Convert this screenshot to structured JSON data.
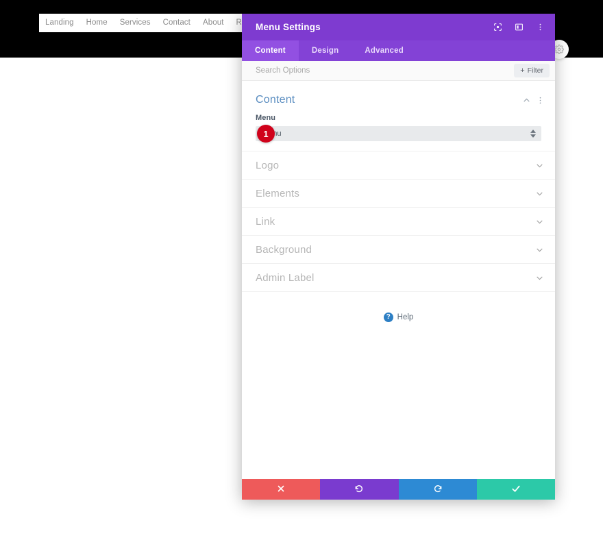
{
  "site": {
    "nav_items": [
      {
        "label": "Landing"
      },
      {
        "label": "Home"
      },
      {
        "label": "Services"
      },
      {
        "label": "Contact"
      },
      {
        "label": "About"
      },
      {
        "label": "Resources"
      }
    ],
    "floating_button_icon": "gear-icon"
  },
  "modal": {
    "title": "Menu Settings",
    "title_actions": [
      {
        "name": "focus-target-icon"
      },
      {
        "name": "panel-layout-icon"
      },
      {
        "name": "more-options-icon"
      }
    ],
    "tabs": [
      {
        "label": "Content",
        "active": true
      },
      {
        "label": "Design",
        "active": false
      },
      {
        "label": "Advanced",
        "active": false
      }
    ],
    "search": {
      "placeholder": "Search Options",
      "value": ""
    },
    "filter_label": "Filter",
    "content_section": {
      "title": "Content",
      "collapse_icon": "chevron-up-icon",
      "more_icon": "more-options-icon",
      "field": {
        "label": "Menu",
        "value": "Menu",
        "badge": "1"
      }
    },
    "sections": [
      {
        "label": "Logo"
      },
      {
        "label": "Elements"
      },
      {
        "label": "Link"
      },
      {
        "label": "Background"
      },
      {
        "label": "Admin Label"
      }
    ],
    "help": {
      "label": "Help",
      "badge": "?"
    },
    "footer_buttons": [
      {
        "name": "cancel-button",
        "icon": "close-icon",
        "color": "#ee5a5a"
      },
      {
        "name": "undo-button",
        "icon": "undo-icon",
        "color": "#7a3bcf"
      },
      {
        "name": "redo-button",
        "icon": "redo-icon",
        "color": "#2d8ad4"
      },
      {
        "name": "save-button",
        "icon": "check-icon",
        "color": "#2cc9a8"
      }
    ]
  }
}
